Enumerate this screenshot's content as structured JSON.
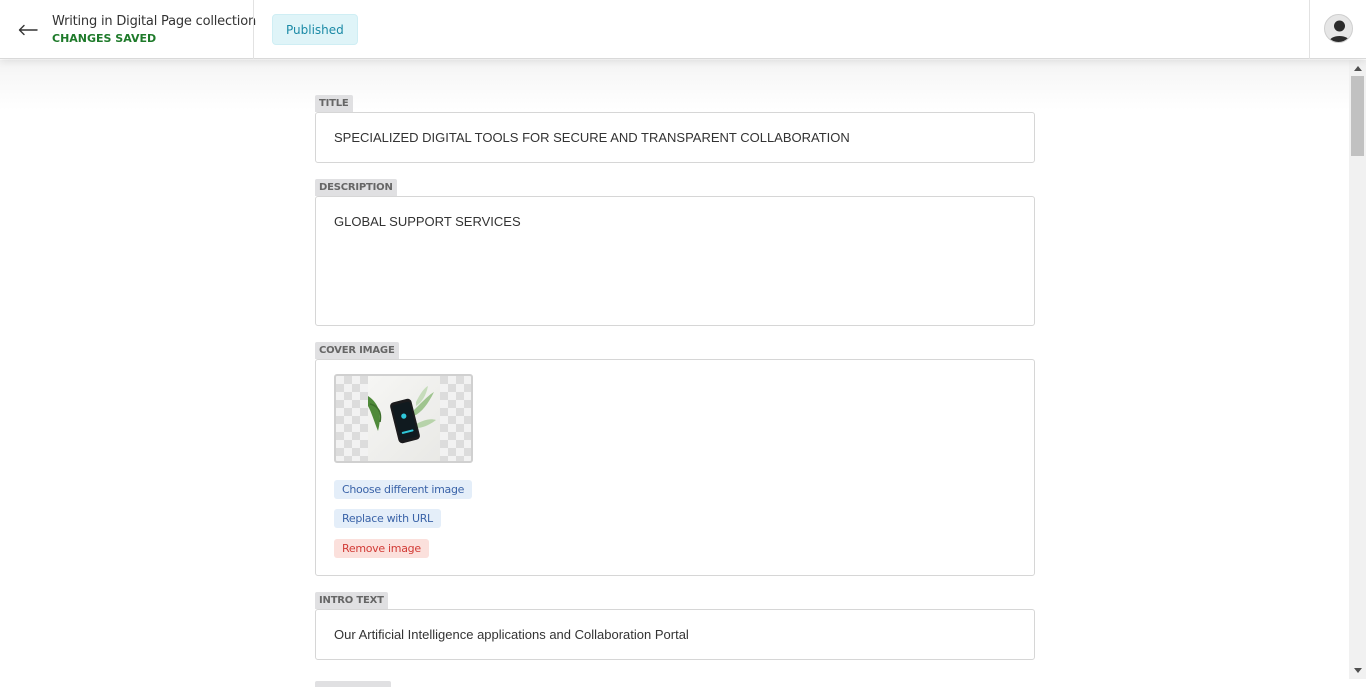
{
  "header": {
    "collection_title": "Writing in Digital Page collection",
    "save_status": "CHANGES SAVED",
    "status_badge": "Published"
  },
  "form": {
    "title": {
      "label": "TITLE",
      "value": "SPECIALIZED DIGITAL TOOLS FOR SECURE AND TRANSPARENT COLLABORATION"
    },
    "description": {
      "label": "DESCRIPTION",
      "value": "GLOBAL SUPPORT SERVICES"
    },
    "cover_image": {
      "label": "COVER IMAGE",
      "choose_label": "Choose different image",
      "replace_label": "Replace with URL",
      "remove_label": "Remove image"
    },
    "intro_text": {
      "label": "INTRO TEXT",
      "value": "Our Artificial Intelligence applications and Collaboration Portal"
    }
  },
  "colors": {
    "save_status": "#1e7a2a",
    "badge_bg": "#dff4f8",
    "badge_text": "#1b8aa6",
    "chip_blue_text": "#3a63a8",
    "chip_red_text": "#d23b36"
  },
  "icons": [
    "arrow-left-icon",
    "user-avatar-icon",
    "scroll-up-icon",
    "scroll-down-icon"
  ]
}
